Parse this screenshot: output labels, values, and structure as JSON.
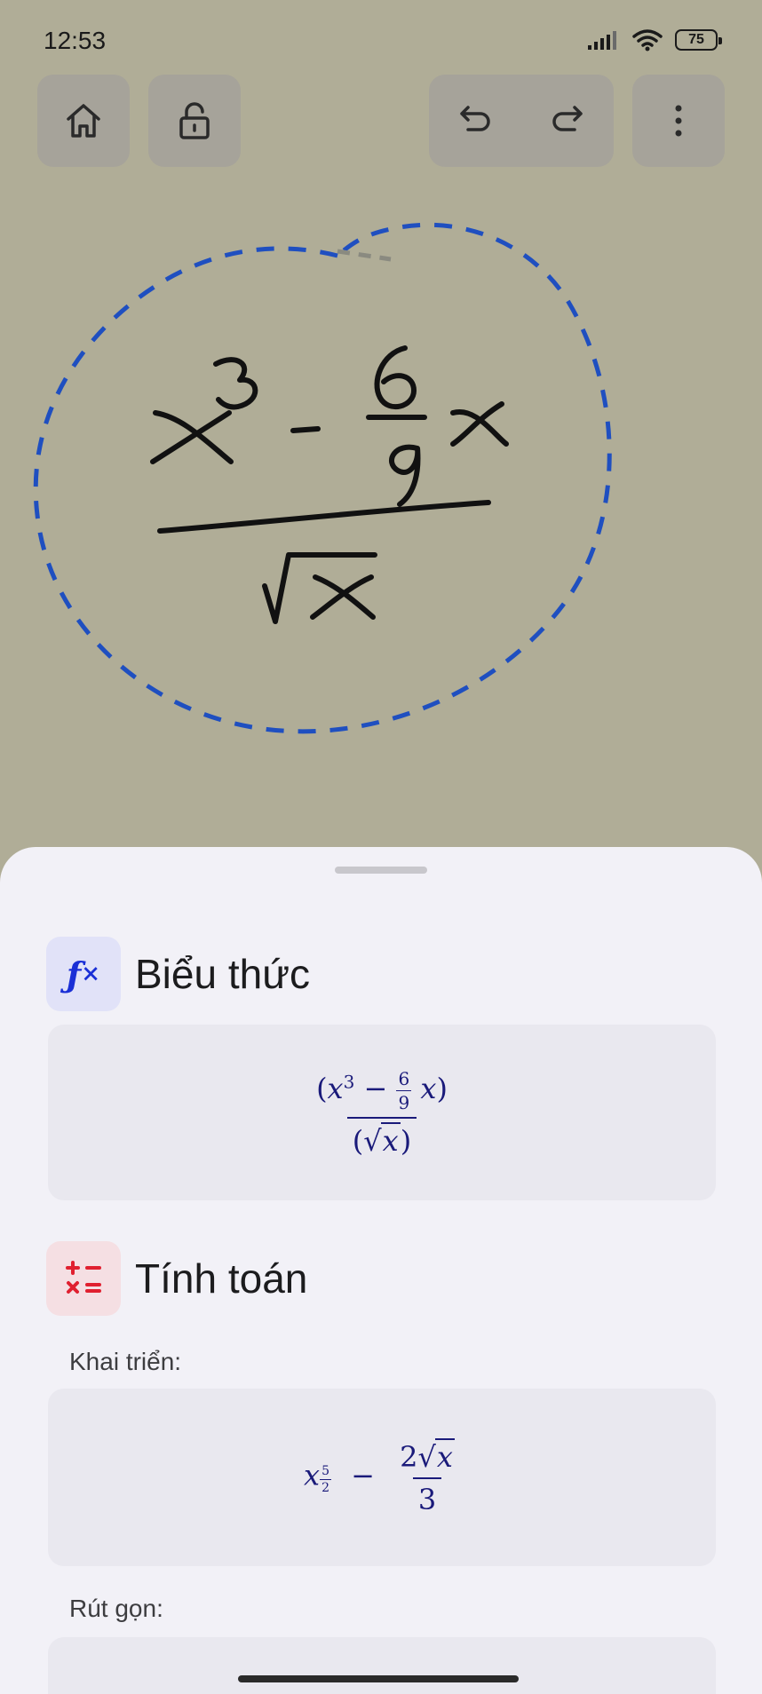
{
  "status": {
    "time": "12:53",
    "battery": "75"
  },
  "sheet": {
    "expression": {
      "title": "Biểu thức"
    },
    "calculation": {
      "title": "Tính toán",
      "expand_label": "Khai triển:",
      "simplify_label": "Rút gọn:"
    }
  },
  "colors": {
    "canvas_bg": "#b0ad97",
    "lasso": "#1f4fc0",
    "math_ink": "#1a1a7a",
    "fx_accent": "#1a2fd6",
    "calc_accent": "#e02030"
  }
}
